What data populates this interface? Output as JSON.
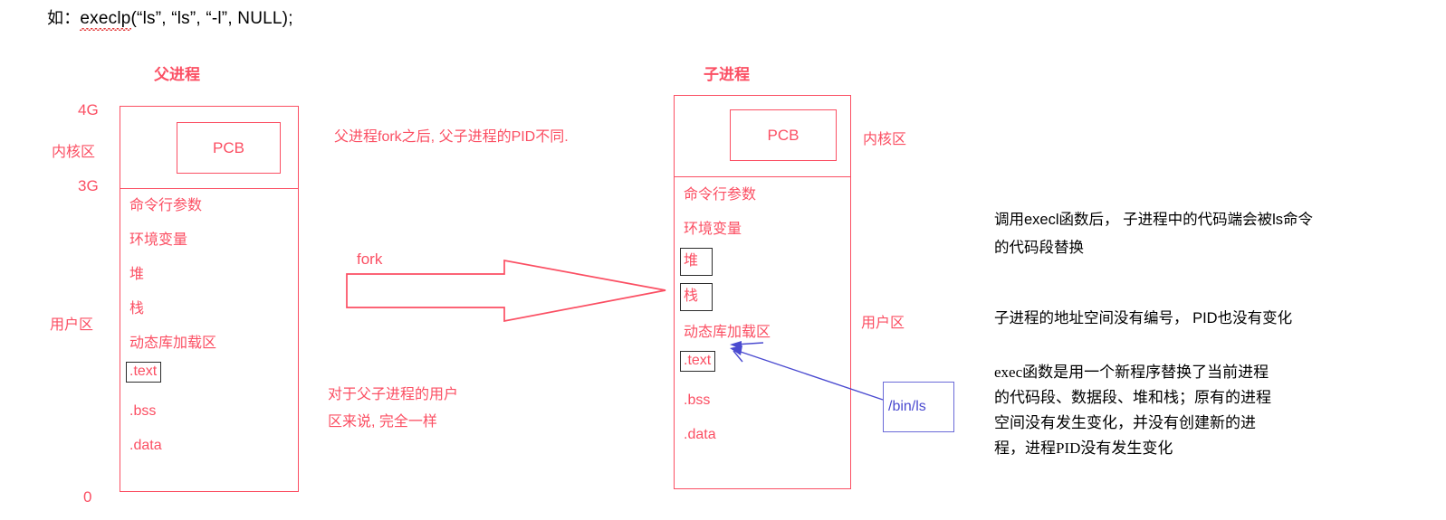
{
  "code_line": {
    "prefix": "如：",
    "func": "execlp",
    "args": "(“ls”, “ls”, “-l”, NULL);"
  },
  "colors": {
    "red": "#fb4f63",
    "blue": "#5b5bd6",
    "black": "#000000"
  },
  "parent_process": {
    "title": "父进程",
    "addr_top": "4G",
    "addr_mid": "3G",
    "addr_bottom": "0",
    "kernel_label": "内核区",
    "user_label": "用户区",
    "pcb": "PCB",
    "segments": [
      {
        "label": "命令行参数",
        "boxed": false
      },
      {
        "label": "环境变量",
        "boxed": false
      },
      {
        "label": "堆",
        "boxed": false
      },
      {
        "label": "栈",
        "boxed": false
      },
      {
        "label": "动态库加载区",
        "boxed": false
      },
      {
        "label": ".text",
        "boxed": true
      },
      {
        "label": ".bss",
        "boxed": false
      },
      {
        "label": ".data",
        "boxed": false
      }
    ]
  },
  "child_process": {
    "title": "子进程",
    "kernel_label": "内核区",
    "user_label": "用户区",
    "pcb": "PCB",
    "segments": [
      {
        "label": "命令行参数",
        "boxed": false
      },
      {
        "label": "环境变量",
        "boxed": false
      },
      {
        "label": "堆",
        "boxed": true
      },
      {
        "label": "栈",
        "boxed": true
      },
      {
        "label": "动态库加载区",
        "boxed": false
      },
      {
        "label": ".text",
        "boxed": true
      },
      {
        "label": ".bss",
        "boxed": false
      },
      {
        "label": ".data",
        "boxed": false
      }
    ]
  },
  "middle": {
    "pid_note": "父进程fork之后, 父子进程的PID不同.",
    "fork_label": "fork",
    "same_note": "对于父子进程的用户\n区来说, 完全一样"
  },
  "binls": {
    "label": "/bin/ls"
  },
  "right_notes": {
    "note1": "调用execl函数后， 子进程中的代码端会被ls命令\n的代码段替换",
    "note2": "子进程的地址空间没有编号， PID也没有变化",
    "note3": "exec函数是用一个新程序替换了当前进程\n的代码段、数据段、堆和栈；原有的进程\n空间没有发生变化，并没有创建新的进\n程，进程PID没有发生变化"
  }
}
